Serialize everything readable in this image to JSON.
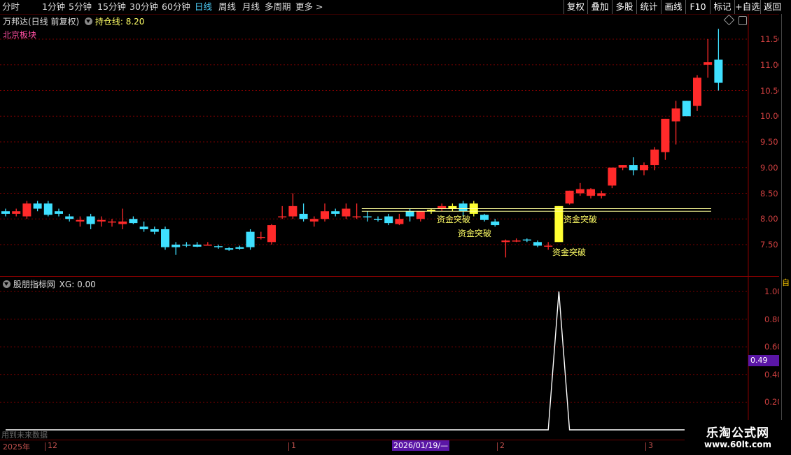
{
  "toolbar": {
    "periods": [
      "分时",
      "1分钟",
      "5分钟",
      "15分钟",
      "30分钟",
      "60分钟",
      "日线",
      "周线",
      "月线",
      "多周期",
      "更多"
    ],
    "active_period": "日线",
    "more_arrow": ">",
    "right_buttons": [
      "复权",
      "叠加",
      "多股",
      "统计",
      "画线",
      "F10",
      "标记",
      "+自选",
      "返回"
    ]
  },
  "main": {
    "stock_title": "万邦达(日线 前复权)",
    "holding_line_label": "持仓线:",
    "holding_line_value": "8.20",
    "sector": "北京板块",
    "y_ticks": [
      "11.50",
      "11.00",
      "10.50",
      "10.00",
      "9.50",
      "9.00",
      "8.50",
      "8.00",
      "7.50"
    ],
    "annotations": [
      "资金突破",
      "资金突破",
      "资金突破",
      "资金突破"
    ]
  },
  "indicator": {
    "name": "股朋指标网",
    "xg_label": "XG:",
    "xg_value": "0.00",
    "y_ticks": [
      "1.00",
      "0.80",
      "0.60",
      "0.40",
      "0.20"
    ],
    "cursor_value": "0.49",
    "watermark": "用到未来数据"
  },
  "datebar": {
    "labels": [
      "2025年",
      "12",
      "1",
      "2026/01/19/—",
      "2",
      "3"
    ]
  },
  "logo": {
    "title": "乐淘公式网",
    "url": "www.60lt.com"
  },
  "colors": {
    "up": "#ff2a2a",
    "down": "#3fe0ff",
    "signal": "#ffff33",
    "grid": "#7a0000",
    "axis_text": "#d04040",
    "highlight": "#ffff99"
  },
  "chart_data": [
    {
      "type": "candlestick",
      "title": "万邦达(日线 前复权)",
      "ylim": [
        7.1,
        11.8
      ],
      "y_ticks": [
        11.5,
        11.0,
        10.5,
        10.0,
        9.5,
        9.0,
        8.5,
        8.0,
        7.5
      ],
      "reference_lines": [
        8.2,
        8.15
      ],
      "x_labels": [
        "12",
        "1",
        "2",
        "3"
      ],
      "candles": [
        [
          8.15,
          8.2,
          8.05,
          8.1
        ],
        [
          8.1,
          8.2,
          8.05,
          8.15
        ],
        [
          8.05,
          8.35,
          8.0,
          8.3
        ],
        [
          8.3,
          8.35,
          8.15,
          8.2
        ],
        [
          8.3,
          8.35,
          8.05,
          8.08
        ],
        [
          8.15,
          8.2,
          8.05,
          8.1
        ],
        [
          8.05,
          8.1,
          7.95,
          8.0
        ],
        [
          7.95,
          8.05,
          7.85,
          7.98
        ],
        [
          8.05,
          8.1,
          7.8,
          7.9
        ],
        [
          7.95,
          8.05,
          7.85,
          7.98
        ],
        [
          7.95,
          8.0,
          7.85,
          7.95
        ],
        [
          7.9,
          8.2,
          7.8,
          7.95
        ],
        [
          8.0,
          8.05,
          7.9,
          7.92
        ],
        [
          7.85,
          7.95,
          7.75,
          7.8
        ],
        [
          7.8,
          7.85,
          7.7,
          7.75
        ],
        [
          7.8,
          7.85,
          7.4,
          7.45
        ],
        [
          7.5,
          7.55,
          7.3,
          7.45
        ],
        [
          7.5,
          7.55,
          7.45,
          7.48
        ],
        [
          7.5,
          7.55,
          7.45,
          7.46
        ],
        [
          7.5,
          7.55,
          7.48,
          7.5
        ],
        [
          7.47,
          7.5,
          7.42,
          7.45
        ],
        [
          7.43,
          7.45,
          7.38,
          7.4
        ],
        [
          7.45,
          7.48,
          7.4,
          7.42
        ],
        [
          7.75,
          7.8,
          7.4,
          7.45
        ],
        [
          7.65,
          7.75,
          7.6,
          7.65
        ],
        [
          7.55,
          7.9,
          7.5,
          7.88
        ],
        [
          8.05,
          8.25,
          8.0,
          8.05
        ],
        [
          8.05,
          8.5,
          8.0,
          8.25
        ],
        [
          8.1,
          8.3,
          7.95,
          8.0
        ],
        [
          7.95,
          8.05,
          7.85,
          8.0
        ],
        [
          8.0,
          8.3,
          7.95,
          8.15
        ],
        [
          8.15,
          8.2,
          8.05,
          8.1
        ],
        [
          8.05,
          8.3,
          8.0,
          8.2
        ],
        [
          8.05,
          8.3,
          8.0,
          8.05
        ],
        [
          8.05,
          8.15,
          7.95,
          8.03
        ],
        [
          8.0,
          8.05,
          7.95,
          7.98
        ],
        [
          8.05,
          8.1,
          7.88,
          7.92
        ],
        [
          7.9,
          8.1,
          7.88,
          8.0
        ],
        [
          8.15,
          8.2,
          7.95,
          8.05
        ],
        [
          8.0,
          8.1,
          7.95,
          8.15
        ],
        [
          8.15,
          8.2,
          8.1,
          8.18
        ],
        [
          8.2,
          8.3,
          8.15,
          8.25
        ],
        [
          8.2,
          8.3,
          8.15,
          8.25
        ],
        [
          8.3,
          8.35,
          8.05,
          8.15
        ],
        [
          8.3,
          8.35,
          8.05,
          8.1
        ],
        [
          8.08,
          8.1,
          7.95,
          7.98
        ],
        [
          7.95,
          8.0,
          7.85,
          7.88
        ],
        [
          7.55,
          7.6,
          7.25,
          7.58
        ],
        [
          7.58,
          7.62,
          7.55,
          7.58
        ],
        [
          7.6,
          7.62,
          7.55,
          7.58
        ],
        [
          7.55,
          7.58,
          7.45,
          7.48
        ],
        [
          7.48,
          7.55,
          7.4,
          7.48
        ],
        [
          7.55,
          8.25,
          7.55,
          8.25
        ],
        [
          8.3,
          8.55,
          8.28,
          8.55
        ],
        [
          8.5,
          8.7,
          8.45,
          8.58
        ],
        [
          8.45,
          8.6,
          8.4,
          8.58
        ],
        [
          8.45,
          8.55,
          8.4,
          8.5
        ],
        [
          8.65,
          9.0,
          8.6,
          9.0
        ],
        [
          9.0,
          9.05,
          8.95,
          9.05
        ],
        [
          9.05,
          9.2,
          8.85,
          8.95
        ],
        [
          8.95,
          9.1,
          8.85,
          9.05
        ],
        [
          9.05,
          9.4,
          8.95,
          9.35
        ],
        [
          9.3,
          9.95,
          9.15,
          9.95
        ],
        [
          9.9,
          10.3,
          9.45,
          10.15
        ],
        [
          10.3,
          10.3,
          10.05,
          10.0
        ],
        [
          10.2,
          10.8,
          10.1,
          10.75
        ],
        [
          11.0,
          11.5,
          10.75,
          11.05
        ],
        [
          11.1,
          11.7,
          10.5,
          10.65
        ]
      ],
      "signals": [
        40,
        42,
        44,
        52
      ]
    },
    {
      "type": "line",
      "title": "股朋指标网",
      "ylim": [
        0,
        1.1
      ],
      "y_ticks": [
        1.0,
        0.8,
        0.6,
        0.4,
        0.2
      ],
      "series": [
        {
          "values": [
            0,
            0,
            0,
            0,
            0,
            0,
            0,
            0,
            0,
            0,
            0,
            0,
            0,
            0,
            0,
            0,
            0,
            0,
            0,
            0,
            0,
            0,
            0,
            0,
            0,
            0,
            0,
            0,
            0,
            0,
            0,
            0,
            0,
            0,
            0,
            0,
            0,
            0,
            0,
            0,
            0,
            0,
            0,
            0,
            0,
            0,
            0,
            0,
            0,
            0,
            0,
            0,
            1,
            0,
            0,
            0,
            0,
            0,
            0,
            0,
            0,
            0,
            0,
            0,
            0,
            0,
            0,
            0
          ]
        }
      ]
    }
  ]
}
